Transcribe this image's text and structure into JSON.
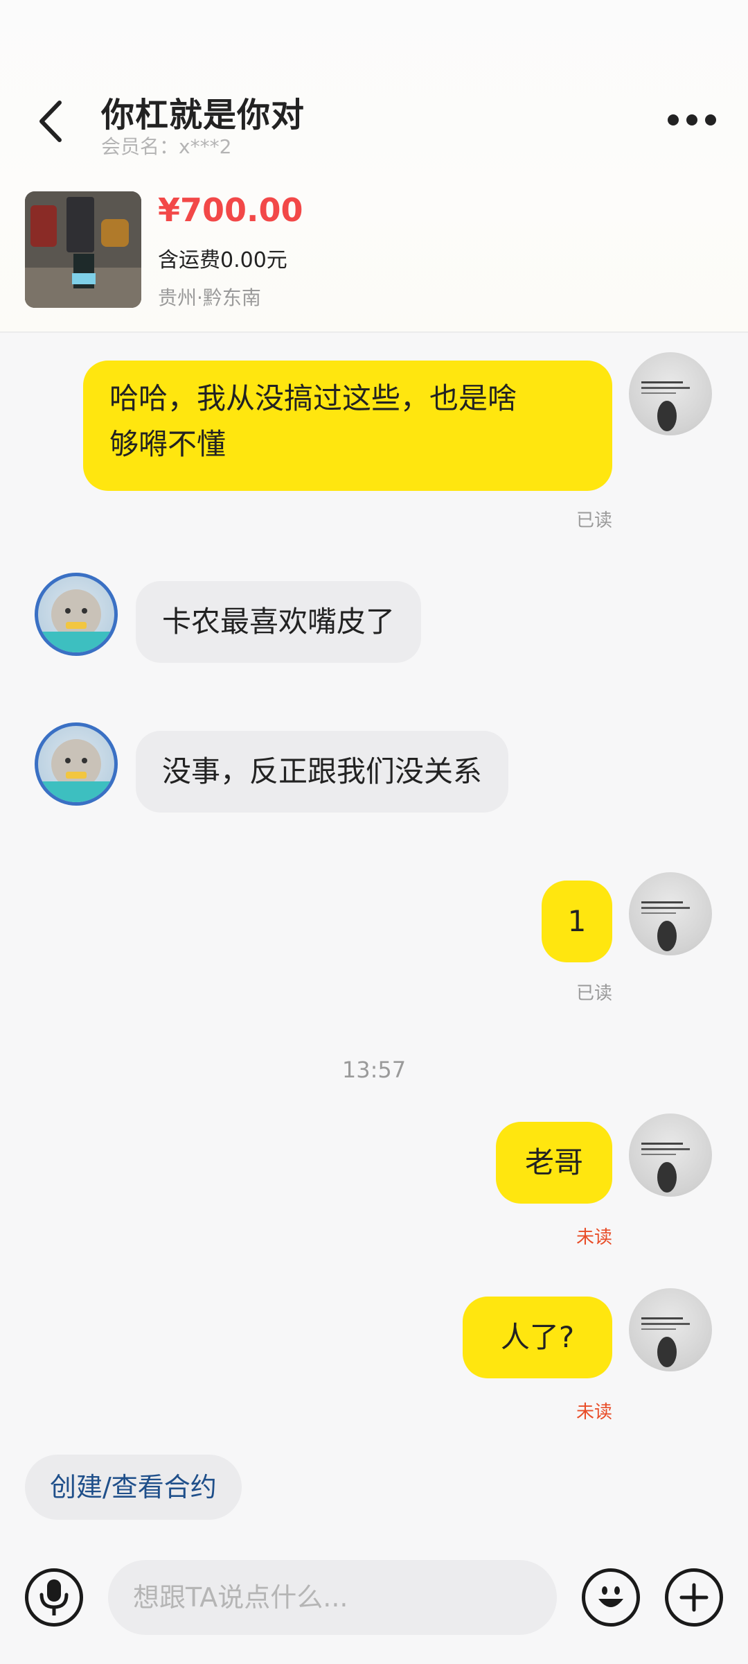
{
  "header": {
    "title": "你杠就是你对",
    "member_label": "会员名：x***2"
  },
  "product": {
    "price": "¥700.00",
    "shipping": "含运费0.00元",
    "location": "贵州·黔东南"
  },
  "messages": [
    {
      "from": "me",
      "text_line1": "哈哈，我从没搞过这些，也是啥",
      "text_line2": "够嘚不懂",
      "status": "已读"
    },
    {
      "from": "them",
      "text": "卡农最喜欢嘴皮了"
    },
    {
      "from": "them",
      "text": "没事，反正跟我们没关系"
    },
    {
      "from": "me",
      "text": "1",
      "status": "已读"
    },
    {
      "time": "13:57"
    },
    {
      "from": "me",
      "text": "老哥",
      "status": "未读"
    },
    {
      "from": "me",
      "text": "人了?",
      "status": "未读"
    }
  ],
  "actions": {
    "contract": "创建/查看合约"
  },
  "input": {
    "placeholder": "想跟TA说点什么..."
  },
  "colors": {
    "accent_yellow": "#ffe60f",
    "price_red": "#f24848",
    "unread_orange": "#e84d28"
  },
  "icons": {
    "back": "chevron-left-icon",
    "more": "more-dots-icon",
    "mic": "microphone-icon",
    "emoji": "emoji-icon",
    "plus": "plus-icon"
  }
}
